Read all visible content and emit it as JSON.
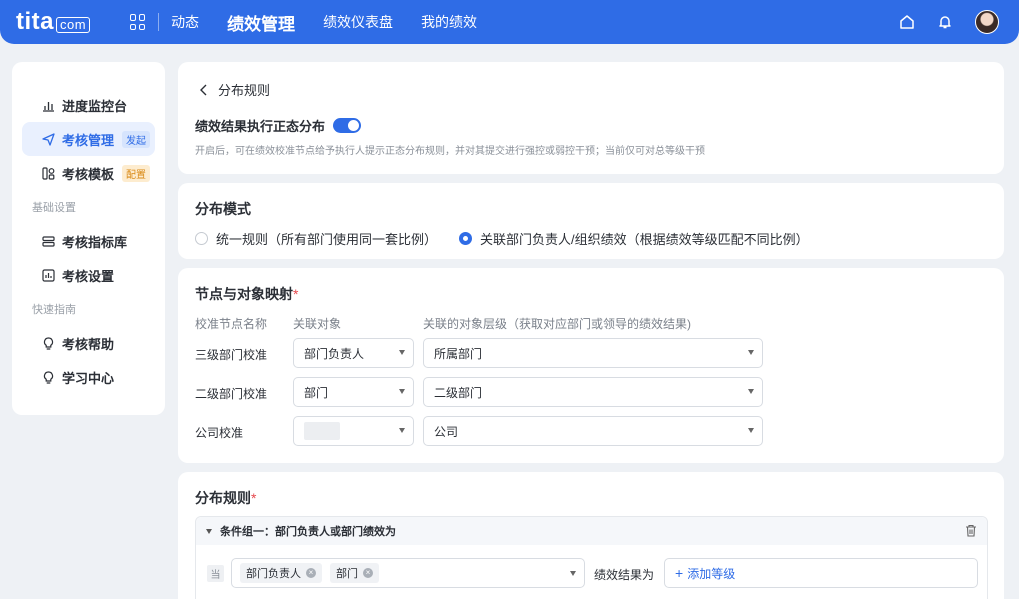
{
  "topbar": {
    "logo_main": "tita",
    "logo_domain": "com",
    "nav": [
      "动态",
      "绩效管理",
      "绩效仪表盘",
      "我的绩效"
    ],
    "active_nav": "绩效管理"
  },
  "sidebar": {
    "items": [
      {
        "label": "进度监控台",
        "icon": "bar-chart-icon"
      },
      {
        "label": "考核管理",
        "badge": "发起",
        "icon": "send-icon"
      },
      {
        "label": "考核模板",
        "badge": "配置",
        "icon": "template-icon"
      }
    ],
    "section_basic": "基础设置",
    "basic_items": [
      {
        "label": "考核指标库",
        "icon": "indicator-library-icon"
      },
      {
        "label": "考核设置",
        "icon": "settings-icon"
      }
    ],
    "section_guide": "快速指南",
    "guide_items": [
      {
        "label": "考核帮助",
        "icon": "bulb-icon"
      },
      {
        "label": "学习中心",
        "icon": "bulb-icon"
      }
    ]
  },
  "header": {
    "back_label": "分布规则",
    "toggle_label": "绩效结果执行正态分布",
    "toggle_on": true,
    "hint": "开启后，可在绩效校准节点给予执行人提示正态分布规则，并对其提交进行强控或弱控干预；当前仅可对总等级干预"
  },
  "mode": {
    "title": "分布模式",
    "option1": "统一规则（所有部门使用同一套比例）",
    "option2": "关联部门负责人/组织绩效（根据绩效等级匹配不同比例）",
    "selected": 2
  },
  "mapping": {
    "title": "节点与对象映射",
    "required_mark": "*",
    "col1": "校准节点名称",
    "col2": "关联对象",
    "col3": "关联的对象层级（获取对应部门或领导的绩效结果)",
    "rows": [
      {
        "node": "三级部门校准",
        "object": "部门负责人",
        "level": "所属部门"
      },
      {
        "node": "二级部门校准",
        "object": "部门",
        "level": "二级部门"
      },
      {
        "node": "公司校准",
        "object": "",
        "level": "公司"
      }
    ]
  },
  "rules": {
    "title": "分布规则",
    "required_mark": "*",
    "group_title": "条件组一：部门负责人或部门绩效为",
    "when_label": "当",
    "tags": [
      "部门负责人",
      "部门"
    ],
    "result_label": "绩效结果为",
    "add_level": "添加等级"
  },
  "colors": {
    "primary": "#2f6ce6",
    "background": "#eef1f5"
  }
}
